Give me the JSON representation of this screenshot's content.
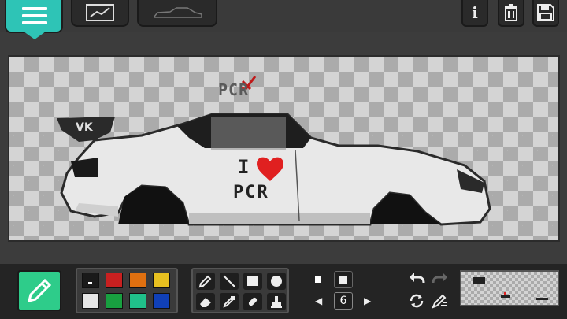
{
  "toolbar": {
    "info_label": "i"
  },
  "canvas": {
    "logo_text": "PCR",
    "decal_letter": "I",
    "decal_text": "PCR"
  },
  "palette": {
    "colors": [
      "#1a1a1a",
      "#c82020",
      "#e07010",
      "#e8c020",
      "#e6e6e6",
      "#18a040",
      "#20c08a",
      "#1040b8"
    ]
  },
  "brush": {
    "size": "6"
  },
  "colors": {
    "accent_teal": "#2ec4b6",
    "accent_green": "#2ecc8a"
  }
}
